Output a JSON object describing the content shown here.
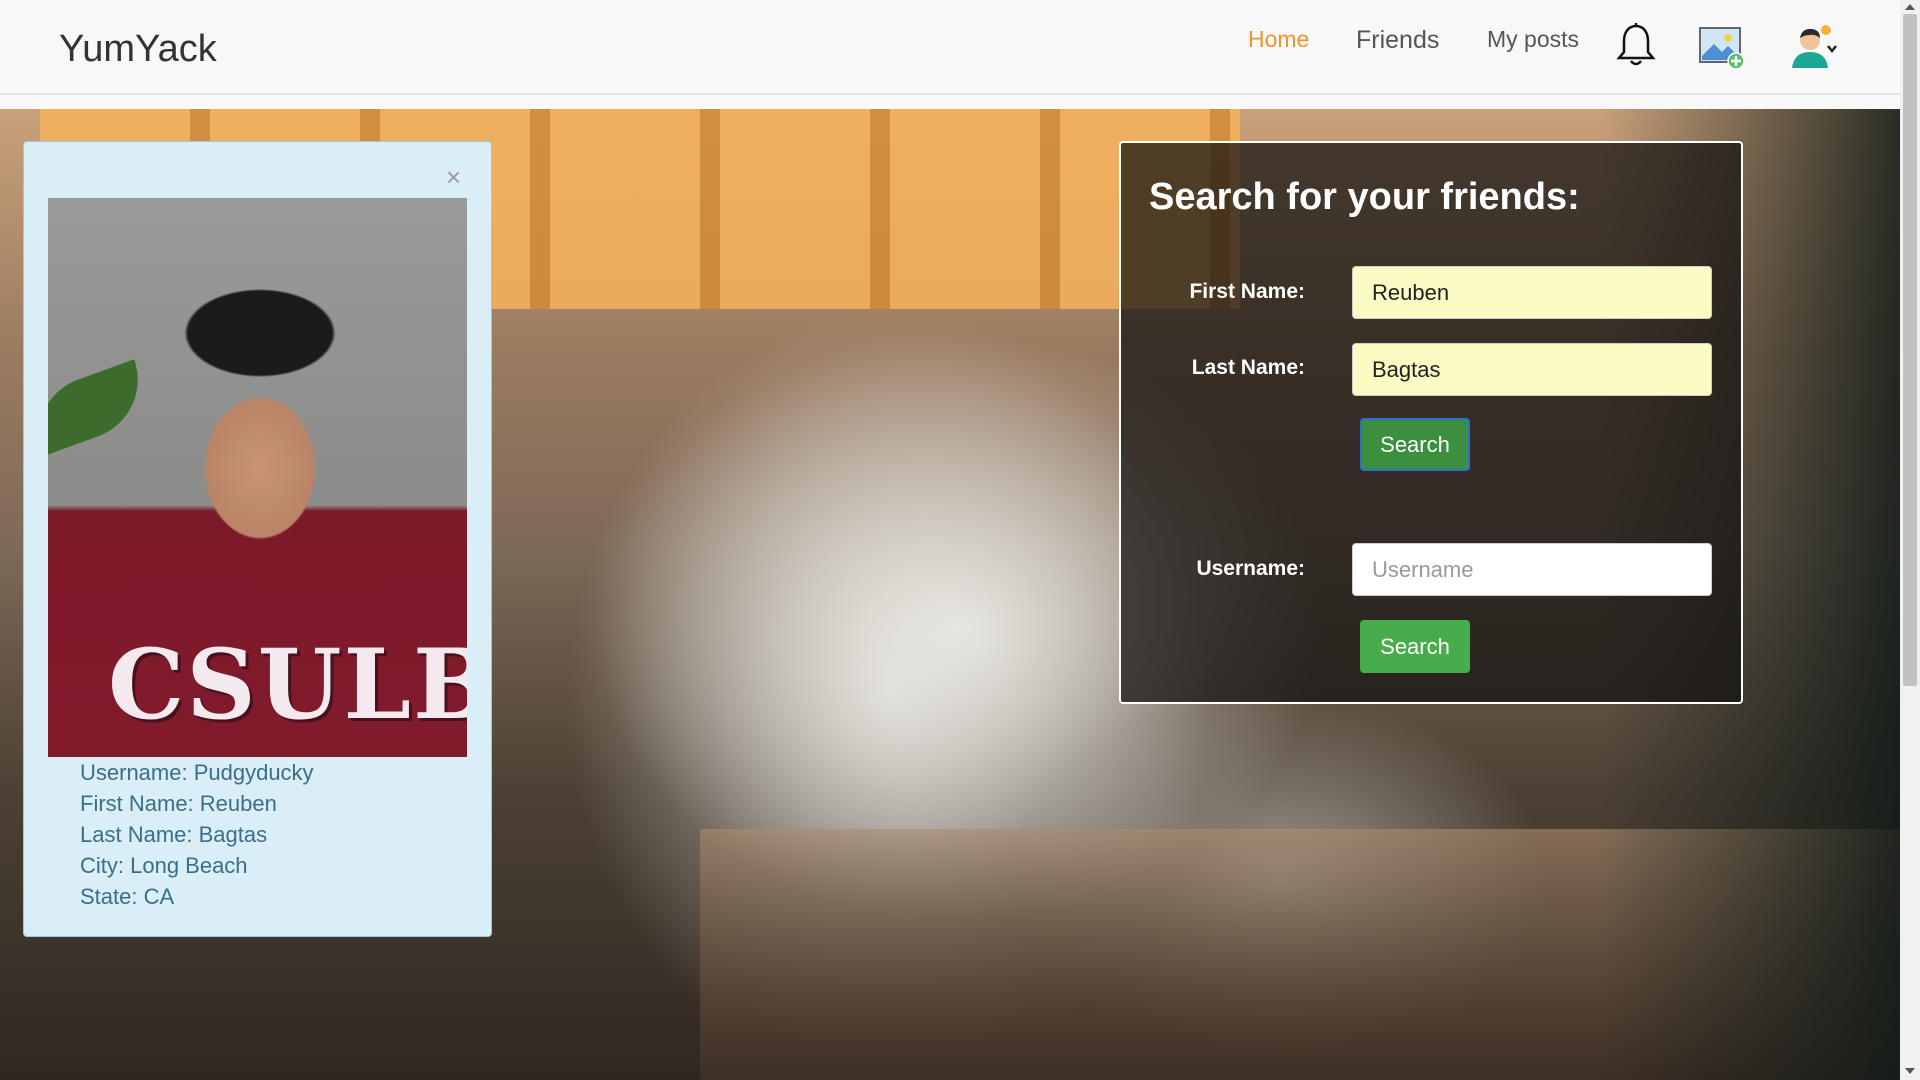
{
  "navbar": {
    "brand": "YumYack",
    "links": {
      "home": "Home",
      "friends": "Friends",
      "posts": "My posts"
    },
    "active_color": "#f0922e",
    "icons": [
      "bell-icon",
      "add-image-icon",
      "user-menu-icon"
    ]
  },
  "profile": {
    "photo_text": "CSULB",
    "close_symbol": "×",
    "username": "Username: Pudgyducky",
    "first_name": "First Name: Reuben",
    "last_name": "Last Name: Bagtas",
    "city": "City: Long Beach",
    "state": "State: CA"
  },
  "search": {
    "title": "Search for your friends:",
    "first_name_label": "First Name:",
    "first_name_value": "Reuben",
    "last_name_label": "Last Name:",
    "last_name_value": "Bagtas",
    "search_label": "Search",
    "username_label": "Username:",
    "username_placeholder": "Username",
    "username_search_label": "Search",
    "button_color": "#46ad4a"
  }
}
